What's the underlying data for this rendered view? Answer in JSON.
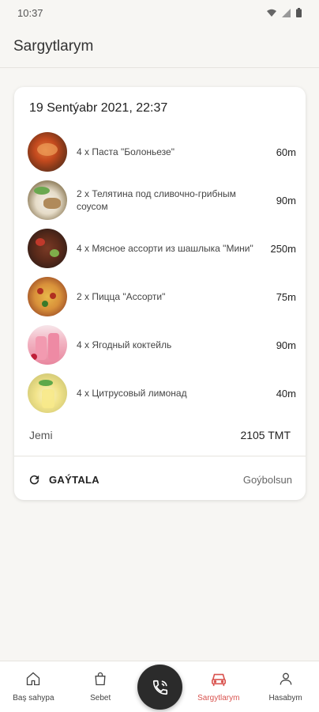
{
  "status_bar": {
    "time": "10:37"
  },
  "app_bar": {
    "title": "Sargytlarym"
  },
  "order": {
    "date": "19 Sentýabr 2021, 22:37",
    "items": [
      {
        "name": "4 x Паста \"Болоньезе\"",
        "price": "60m",
        "image": "pasta-image"
      },
      {
        "name": "2 x Телятина под сливочно-грибным соусом",
        "price": "90m",
        "image": "veal-image"
      },
      {
        "name": "4 x Мясное ассорти из шашлыка \"Мини\"",
        "price": "250m",
        "image": "shashlik-image"
      },
      {
        "name": "2 x Пицца \"Ассорти\"",
        "price": "75m",
        "image": "pizza-image"
      },
      {
        "name": "4 x Ягодный коктейль",
        "price": "90m",
        "image": "berry-cocktail-image"
      },
      {
        "name": "4 x Цитрусовый лимонад",
        "price": "40m",
        "image": "lemonade-image"
      }
    ],
    "total_label": "Jemi",
    "total_value": "2105 TMT",
    "repeat_label": "GAÝTALA",
    "cancel_label": "Goýbolsun"
  },
  "bottom_nav": {
    "items": [
      {
        "label": "Baş sahypa",
        "icon": "home-icon"
      },
      {
        "label": "Sebet",
        "icon": "bag-icon"
      },
      {
        "label": "Sargytlarym",
        "icon": "car-icon",
        "active": true
      },
      {
        "label": "Hasabym",
        "icon": "user-icon"
      }
    ],
    "call_icon": "phone-icon"
  },
  "colors": {
    "accent": "#d9534f",
    "background": "#f7f6f3",
    "call_button": "#2b2b2b"
  }
}
